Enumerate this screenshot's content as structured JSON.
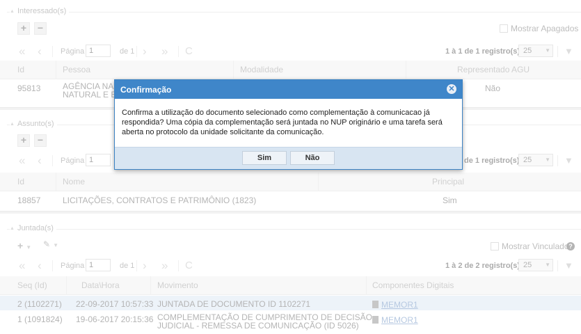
{
  "interessados": {
    "legend": "Interessado(s)",
    "mostrar_apagados": "Mostrar Apagados",
    "pager": {
      "pagina_label": "Página",
      "pagina_value": "1",
      "de_label": "de 1",
      "info": "1 à 1 de 1 registro(s)",
      "page_size": "25"
    },
    "columns": [
      "Id",
      "Pessoa",
      "Modalidade",
      "Representado AGU"
    ],
    "rows": [
      {
        "id": "95813",
        "pessoa_line1": "AGÊNCIA NAC",
        "pessoa_line2": "NATURAL E B",
        "representado": "Não"
      }
    ]
  },
  "assuntos": {
    "legend": "Assunto(s)",
    "pager": {
      "pagina_label": "Página",
      "pagina_value": "1",
      "info": "de 1 registro(s)",
      "page_size": "25"
    },
    "columns": [
      "Id",
      "Nome",
      "Principal"
    ],
    "rows": [
      {
        "id": "18857",
        "nome": "LICITAÇÕES, CONTRATOS E PATRIMÔNIO (1823)",
        "principal": "Sim"
      }
    ]
  },
  "juntadas": {
    "legend": "Juntada(s)",
    "mostrar_vinculados": "Mostrar Vinculados",
    "pager": {
      "pagina_label": "Página",
      "pagina_value": "1",
      "de_label": "de 1",
      "info": "1 à 2 de 2 registro(s)",
      "page_size": "25"
    },
    "columns": [
      "Seq (Id)",
      "Data\\Hora",
      "Movimento",
      "Componentes Digitais"
    ],
    "rows": [
      {
        "seq": "2 (1102271)",
        "datahora": "22-09-2017 10:57:33",
        "movimento_line1": "JUNTADA DE DOCUMENTO ID 1102271",
        "movimento_line2": "",
        "componente": "MEMOR1"
      },
      {
        "seq": "1 (1091824)",
        "datahora": "19-06-2017 20:15:36",
        "movimento_line1": "COMPLEMENTAÇÃO DE CUMPRIMENTO DE DECISÃO",
        "movimento_line2": "JUDICIAL - REMESSA DE COMUNICAÇÃO (ID 5026)",
        "componente": "MEMOR1"
      }
    ]
  },
  "modal": {
    "title": "Confirmação",
    "body_line1": "Confirma a utilização do documento selecionado como complementação à comunicacao já",
    "body_line2": "respondida? Uma cópia da complementação será juntada no NUP originário e uma tarefa será",
    "body_line3": "aberta no protocolo da unidade solicitante da comunicação.",
    "yes_label": "Sim",
    "no_label": "Não"
  },
  "icons": {
    "add": "+",
    "remove": "−",
    "first": "«",
    "prev": "‹",
    "next": "›",
    "last": "»",
    "refresh": "C",
    "filter": "▼",
    "wrench": "🔧",
    "help": "?",
    "close": "✕"
  },
  "colors": {
    "modal_header": "#3f86c9",
    "highlight_row": "#dfe9f5",
    "link": "#7a9cc8"
  }
}
